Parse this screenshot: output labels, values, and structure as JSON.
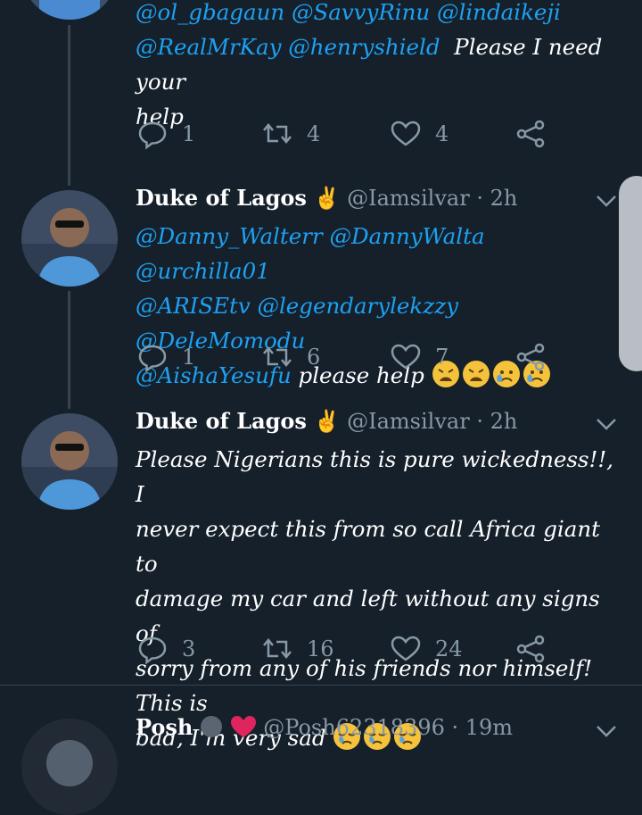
{
  "tweet0": {
    "line1": "@ol_gbagaun @SavvyRinu @lindaikeji",
    "line2_mentions": "@RealMrKay @henryshield",
    "line2_text": "Please I  need your",
    "line3": "help",
    "reply_count": "1",
    "retweet_count": "4",
    "like_count": "4"
  },
  "tweet1": {
    "name": "Duke of Lagos",
    "name_emoji": "✌",
    "handle": "@Iamsilvar",
    "time": "· 2h",
    "line1": "@Danny_Walterr @DannyWalta @urchilla01",
    "line2": "@ARISEtv @legendarylekzzy @DeleMomodu",
    "line3_mention": "@AishaYesufu",
    "line3_text": "please help",
    "reply_count": "1",
    "retweet_count": "6",
    "like_count": "7"
  },
  "tweet2": {
    "name": "Duke of Lagos",
    "name_emoji": "✌",
    "handle": "@Iamsilvar",
    "time": "· 2h",
    "lines": [
      "Please Nigerians this is pure wickedness!!, I",
      "never expect this from so call Africa giant to",
      "damage my car and left without any signs of",
      "sorry from any of his friends nor himself! This is",
      "bad, I'm very sad"
    ],
    "reply_count": "3",
    "retweet_count": "16",
    "like_count": "24"
  },
  "tweet3": {
    "name": "Posh",
    "handle": "@Posh62318396",
    "time": "· 19m"
  },
  "colors": {
    "background": "#15202b",
    "mention": "#1da1f2",
    "muted": "#8899a6",
    "divider": "#38444d"
  }
}
